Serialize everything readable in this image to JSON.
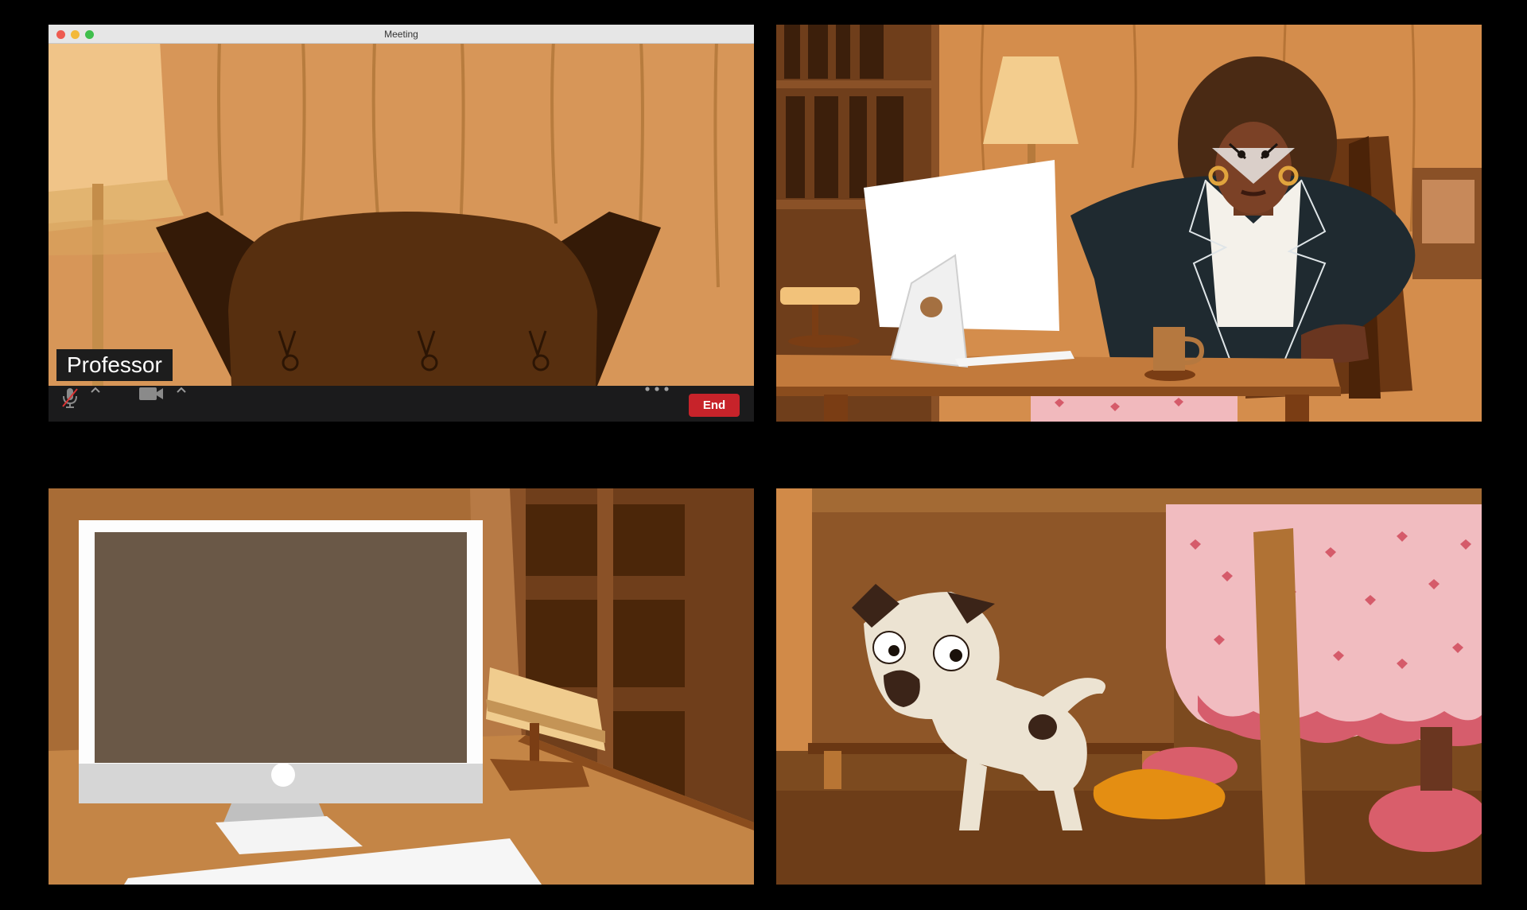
{
  "window": {
    "title": "Meeting"
  },
  "participants": [
    {
      "name": "Professor"
    }
  ],
  "toolbar": {
    "end_label": "End",
    "icons": [
      "microphone-muted-icon",
      "chevron-up-icon",
      "video-camera-icon",
      "chevron-up-icon",
      "more-options-icon"
    ]
  },
  "colors": {
    "end_button": "#c7232a",
    "toolbar": "#1b1b1c",
    "mic_muted_slash": "#d93434"
  }
}
